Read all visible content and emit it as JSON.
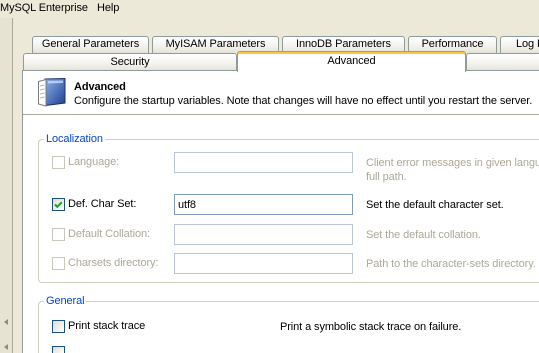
{
  "menubar": {
    "items": [
      {
        "label": "MySQL Enterprise"
      },
      {
        "label": "Help"
      }
    ]
  },
  "left_pane": {
    "arrow_icon": "arrow-left-icon"
  },
  "tabs": {
    "row1": [
      {
        "label": "General Parameters"
      },
      {
        "label": "MyISAM Parameters"
      },
      {
        "label": "InnoDB Parameters"
      },
      {
        "label": "Performance"
      },
      {
        "label": "Log F"
      }
    ],
    "row2": [
      {
        "label": "Security"
      },
      {
        "label": "Advanced",
        "selected": true
      },
      {}
    ]
  },
  "header": {
    "icon": "manual-book-icon",
    "title": "Advanced",
    "description": "Configure the startup variables. Note that changes will have no effect until you restart the server."
  },
  "localization": {
    "legend": "Localization",
    "options": [
      {
        "label": "Language:",
        "checked": false,
        "enabled": false,
        "value": "",
        "description": "Client error messages in given langua",
        "description_line2": "full path."
      },
      {
        "label": "Def. Char Set:",
        "checked": true,
        "enabled": true,
        "value": "utf8",
        "description": "Set the default character set."
      },
      {
        "label": "Default Collation:",
        "checked": false,
        "enabled": false,
        "value": "",
        "description": "Set the default collation."
      },
      {
        "label": "Charsets directory:",
        "checked": false,
        "enabled": false,
        "value": "",
        "description": "Path to the character-sets directory."
      }
    ]
  },
  "general": {
    "legend": "General",
    "options": [
      {
        "label": "Print stack trace",
        "checked": false,
        "enabled": true,
        "description": "Print a symbolic stack trace on failure."
      },
      {
        "checked": false,
        "enabled": true
      }
    ]
  },
  "colors": {
    "window_bg": "#ECE9D8",
    "panel_bg": "#FFFFFF",
    "tab_border": "#919B9C",
    "selected_tab_accent": "#FFC83C",
    "group_legend": "#0046D5",
    "group_border": "#D0D0BF",
    "disabled_text": "#ACA899",
    "checkmark": "#21A121",
    "input_border": "#7F9DB9"
  }
}
